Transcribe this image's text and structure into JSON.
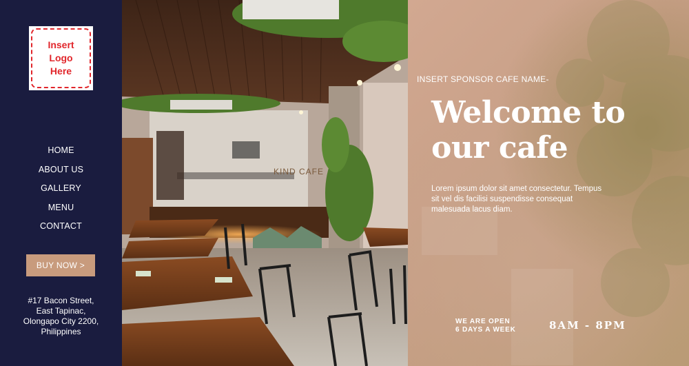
{
  "logo": {
    "text": "Insert\nLogo\nHere"
  },
  "nav": {
    "items": [
      {
        "label": "HOME"
      },
      {
        "label": "ABOUT US"
      },
      {
        "label": "GALLERY"
      },
      {
        "label": "MENU"
      },
      {
        "label": "CONTACT"
      }
    ]
  },
  "cta": {
    "label": "BUY NOW >"
  },
  "address": {
    "lines": [
      "#17 Bacon Street,",
      "East Tapinac,",
      "Olongapo City 2200,",
      "Philippines"
    ]
  },
  "hero": {
    "sponsor": "INSERT SPONSOR CAFE NAME-",
    "headline": "Welcome to\nour cafe",
    "intro": "Lorem ipsum dolor sit amet consectetur. Tempus sit vel dis facilisi suspendisse consequat malesuada lacus diam.",
    "open_label": "WE ARE OPEN\n6 DAYS A WEEK",
    "hours": "8AM - 8PM",
    "photo_sign": "KIND CAFE"
  },
  "colors": {
    "sidebar": "#1a1c3f",
    "accent": "#c89b7d",
    "logo_red": "#e1262b"
  }
}
